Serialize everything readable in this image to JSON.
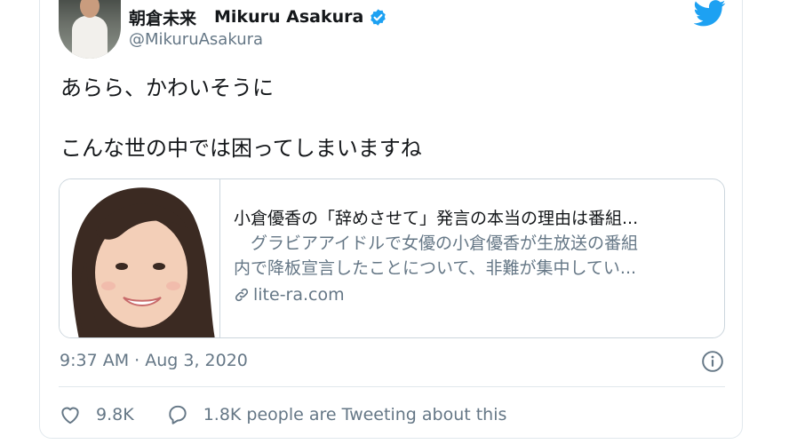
{
  "tweet": {
    "author": {
      "display_name_jp": "朝倉未来",
      "display_name_en": "Mikuru Asakura",
      "handle": "@MikuruAsakura",
      "verified": true
    },
    "text_lines": [
      "あらら、かわいそうに",
      "こんな世の中では困ってしまいますね"
    ],
    "link_card": {
      "title": "小倉優香の「辞めさせて」発言の本当の理由は番組...",
      "description_lines": [
        "　グラビアアイドルで女優の小倉優香が生放送の番組",
        "内で降板宣言したことについて、非難が集中してい..."
      ],
      "domain": "lite-ra.com"
    },
    "timestamp": "9:37 AM · Aug 3, 2020",
    "likes": "9.8K",
    "tweeting_about": "1.8K people are Tweeting about this"
  },
  "icons": {
    "verified": "verified-badge-icon",
    "brand": "twitter-bird-icon",
    "info": "info-icon",
    "like": "heart-icon",
    "reply": "speech-bubble-icon",
    "link": "link-icon"
  },
  "colors": {
    "brand_blue": "#1da1f2",
    "text_primary": "#14171a",
    "text_secondary": "#657786",
    "border": "#e1e8ed"
  }
}
